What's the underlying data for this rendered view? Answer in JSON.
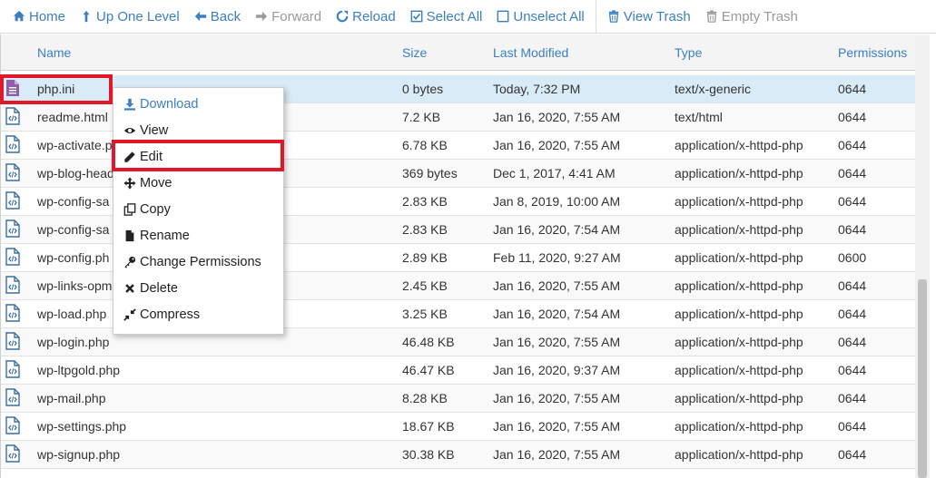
{
  "toolbar": {
    "home": "Home",
    "up_one_level": "Up One Level",
    "back": "Back",
    "forward": "Forward",
    "reload": "Reload",
    "select_all": "Select All",
    "unselect_all": "Unselect All",
    "view_trash": "View Trash",
    "empty_trash": "Empty Trash"
  },
  "columns": {
    "name": "Name",
    "size": "Size",
    "last_modified": "Last Modified",
    "type": "Type",
    "permissions": "Permissions"
  },
  "files": [
    {
      "name": "php.ini",
      "size": "0 bytes",
      "modified": "Today, 7:32 PM",
      "type": "text/x-generic",
      "perms": "0644",
      "icon": "text-file-icon",
      "selected": true
    },
    {
      "name": "readme.html",
      "size": "7.2 KB",
      "modified": "Jan 16, 2020, 7:55 AM",
      "type": "text/html",
      "perms": "0644",
      "icon": "code-file-icon"
    },
    {
      "name": "wp-activate.p",
      "size": "6.78 KB",
      "modified": "Jan 16, 2020, 7:55 AM",
      "type": "application/x-httpd-php",
      "perms": "0644",
      "icon": "code-file-icon"
    },
    {
      "name": "wp-blog-head",
      "size": "369 bytes",
      "modified": "Dec 1, 2017, 4:41 AM",
      "type": "application/x-httpd-php",
      "perms": "0644",
      "icon": "code-file-icon"
    },
    {
      "name": "wp-config-sa",
      "size": "2.83 KB",
      "modified": "Jan 8, 2019, 10:00 AM",
      "type": "application/x-httpd-php",
      "perms": "0644",
      "icon": "code-file-icon"
    },
    {
      "name": "wp-config-sa",
      "size": "2.83 KB",
      "modified": "Jan 16, 2020, 7:54 AM",
      "type": "application/x-httpd-php",
      "perms": "0644",
      "icon": "code-file-icon"
    },
    {
      "name": "wp-config.ph",
      "size": "2.89 KB",
      "modified": "Feb 11, 2020, 9:27 AM",
      "type": "application/x-httpd-php",
      "perms": "0600",
      "icon": "code-file-icon"
    },
    {
      "name": "wp-links-opm",
      "size": "2.45 KB",
      "modified": "Jan 16, 2020, 7:55 AM",
      "type": "application/x-httpd-php",
      "perms": "0644",
      "icon": "code-file-icon"
    },
    {
      "name": "wp-load.php",
      "size": "3.25 KB",
      "modified": "Jan 16, 2020, 7:54 AM",
      "type": "application/x-httpd-php",
      "perms": "0644",
      "icon": "code-file-icon"
    },
    {
      "name": "wp-login.php",
      "size": "46.48 KB",
      "modified": "Jan 16, 2020, 7:55 AM",
      "type": "application/x-httpd-php",
      "perms": "0644",
      "icon": "code-file-icon"
    },
    {
      "name": "wp-ltpgold.php",
      "size": "46.47 KB",
      "modified": "Jan 16, 2020, 9:37 AM",
      "type": "application/x-httpd-php",
      "perms": "0644",
      "icon": "code-file-icon"
    },
    {
      "name": "wp-mail.php",
      "size": "8.28 KB",
      "modified": "Jan 16, 2020, 7:55 AM",
      "type": "application/x-httpd-php",
      "perms": "0644",
      "icon": "code-file-icon"
    },
    {
      "name": "wp-settings.php",
      "size": "18.67 KB",
      "modified": "Jan 16, 2020, 7:55 AM",
      "type": "application/x-httpd-php",
      "perms": "0644",
      "icon": "code-file-icon"
    },
    {
      "name": "wp-signup.php",
      "size": "30.38 KB",
      "modified": "Jan 16, 2020, 7:55 AM",
      "type": "application/x-httpd-php",
      "perms": "0644",
      "icon": "code-file-icon"
    }
  ],
  "context_menu": {
    "items": [
      {
        "label": "Download",
        "icon": "download-icon"
      },
      {
        "label": "View",
        "icon": "eye-icon"
      },
      {
        "label": "Edit",
        "icon": "pencil-icon"
      },
      {
        "label": "Move",
        "icon": "move-arrows-icon"
      },
      {
        "label": "Copy",
        "icon": "copy-icon"
      },
      {
        "label": "Rename",
        "icon": "file-icon"
      },
      {
        "label": "Change Permissions",
        "icon": "key-icon"
      },
      {
        "label": "Delete",
        "icon": "x-icon"
      },
      {
        "label": "Compress",
        "icon": "compress-icon"
      }
    ]
  },
  "colors": {
    "accent": "#3c7fc0",
    "selected_row": "#d9ebf7",
    "highlight": "#e0192a"
  }
}
